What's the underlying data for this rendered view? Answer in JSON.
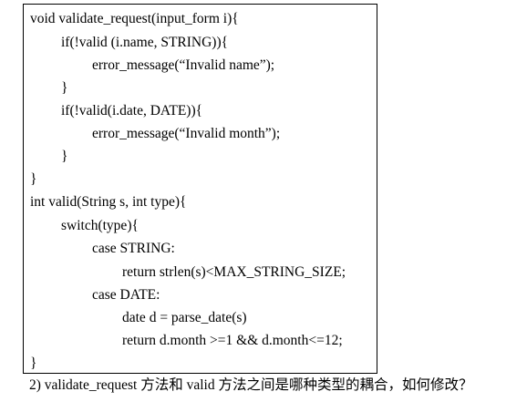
{
  "code_lines": [
    "void validate_request(input_form i){",
    "if(!valid (i.name, STRING)){",
    "error_message(“Invalid name”);",
    "}",
    "if(!valid(i.date, DATE)){",
    "error_message(“Invalid month”);",
    "}",
    "}",
    "int valid(String s, int type){",
    "switch(type){",
    "case STRING:",
    "return strlen(s)<MAX_STRING_SIZE;",
    "case DATE:",
    "date d = parse_date(s)",
    "return d.month >=1 && d.month<=12;",
    "}"
  ],
  "question": "2) validate_request 方法和 valid 方法之间是哪种类型的耦合，如何修改？"
}
